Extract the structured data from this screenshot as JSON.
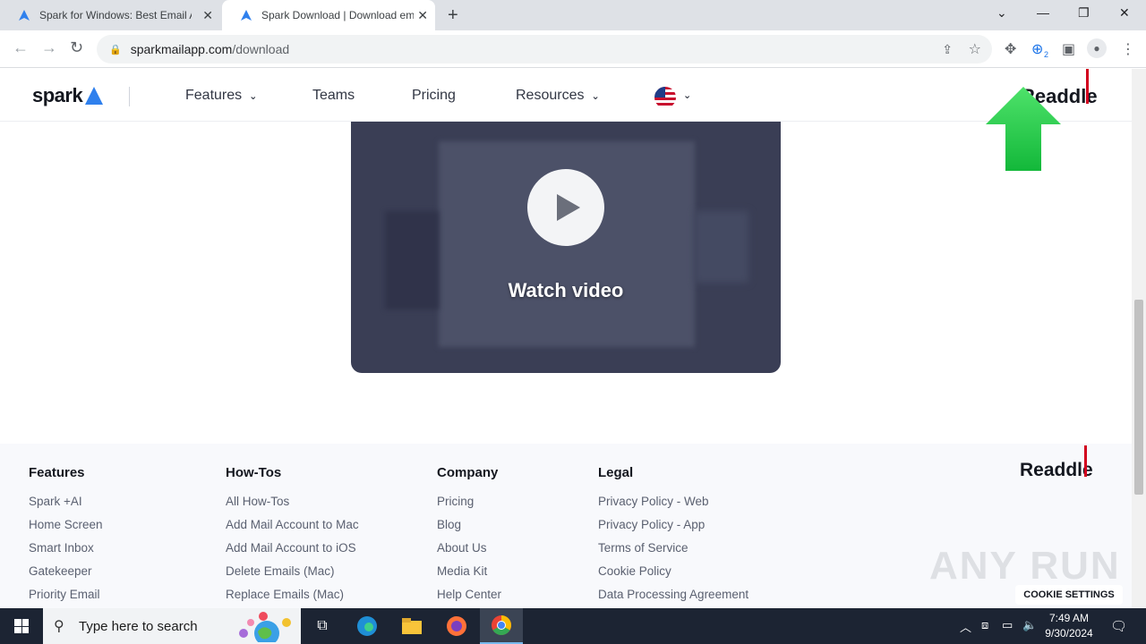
{
  "browser": {
    "tabs": [
      {
        "title": "Spark for Windows: Best Email A",
        "active": false
      },
      {
        "title": "Spark Download | Download em",
        "active": true
      }
    ],
    "url_domain": "sparkmailapp.com",
    "url_path": "/download",
    "download_badge": "2"
  },
  "header": {
    "logo": "spark",
    "nav": [
      {
        "label": "Features",
        "has_dropdown": true
      },
      {
        "label": "Teams",
        "has_dropdown": false
      },
      {
        "label": "Pricing",
        "has_dropdown": false
      },
      {
        "label": "Resources",
        "has_dropdown": true
      }
    ],
    "brand": "Readdle"
  },
  "video": {
    "label": "Watch video"
  },
  "footer": {
    "columns": [
      {
        "heading": "Features",
        "links": [
          "Spark +AI",
          "Home Screen",
          "Smart Inbox",
          "Gatekeeper",
          "Priority Email"
        ]
      },
      {
        "heading": "How-Tos",
        "links": [
          "All How-Tos",
          "Add Mail Account to Mac",
          "Add Mail Account to iOS",
          "Delete Emails (Mac)",
          "Replace Emails (Mac)"
        ]
      },
      {
        "heading": "Company",
        "links": [
          "Pricing",
          "Blog",
          "About Us",
          "Media Kit",
          "Help Center"
        ]
      },
      {
        "heading": "Legal",
        "links": [
          "Privacy Policy - Web",
          "Privacy Policy - App",
          "Terms of Service",
          "Cookie Policy",
          "Data Processing Agreement"
        ]
      }
    ],
    "brand": "Readdle",
    "cookie_button": "COOKIE SETTINGS",
    "watermark": "ANY RUN"
  },
  "taskbar": {
    "search_placeholder": "Type here to search",
    "time": "7:49 AM",
    "date": "9/30/2024"
  },
  "colors": {
    "accent_blue": "#2f80ed",
    "readdle_red": "#d2001e",
    "video_bg": "#3a3e55",
    "arrow_green": "#22c84a"
  }
}
